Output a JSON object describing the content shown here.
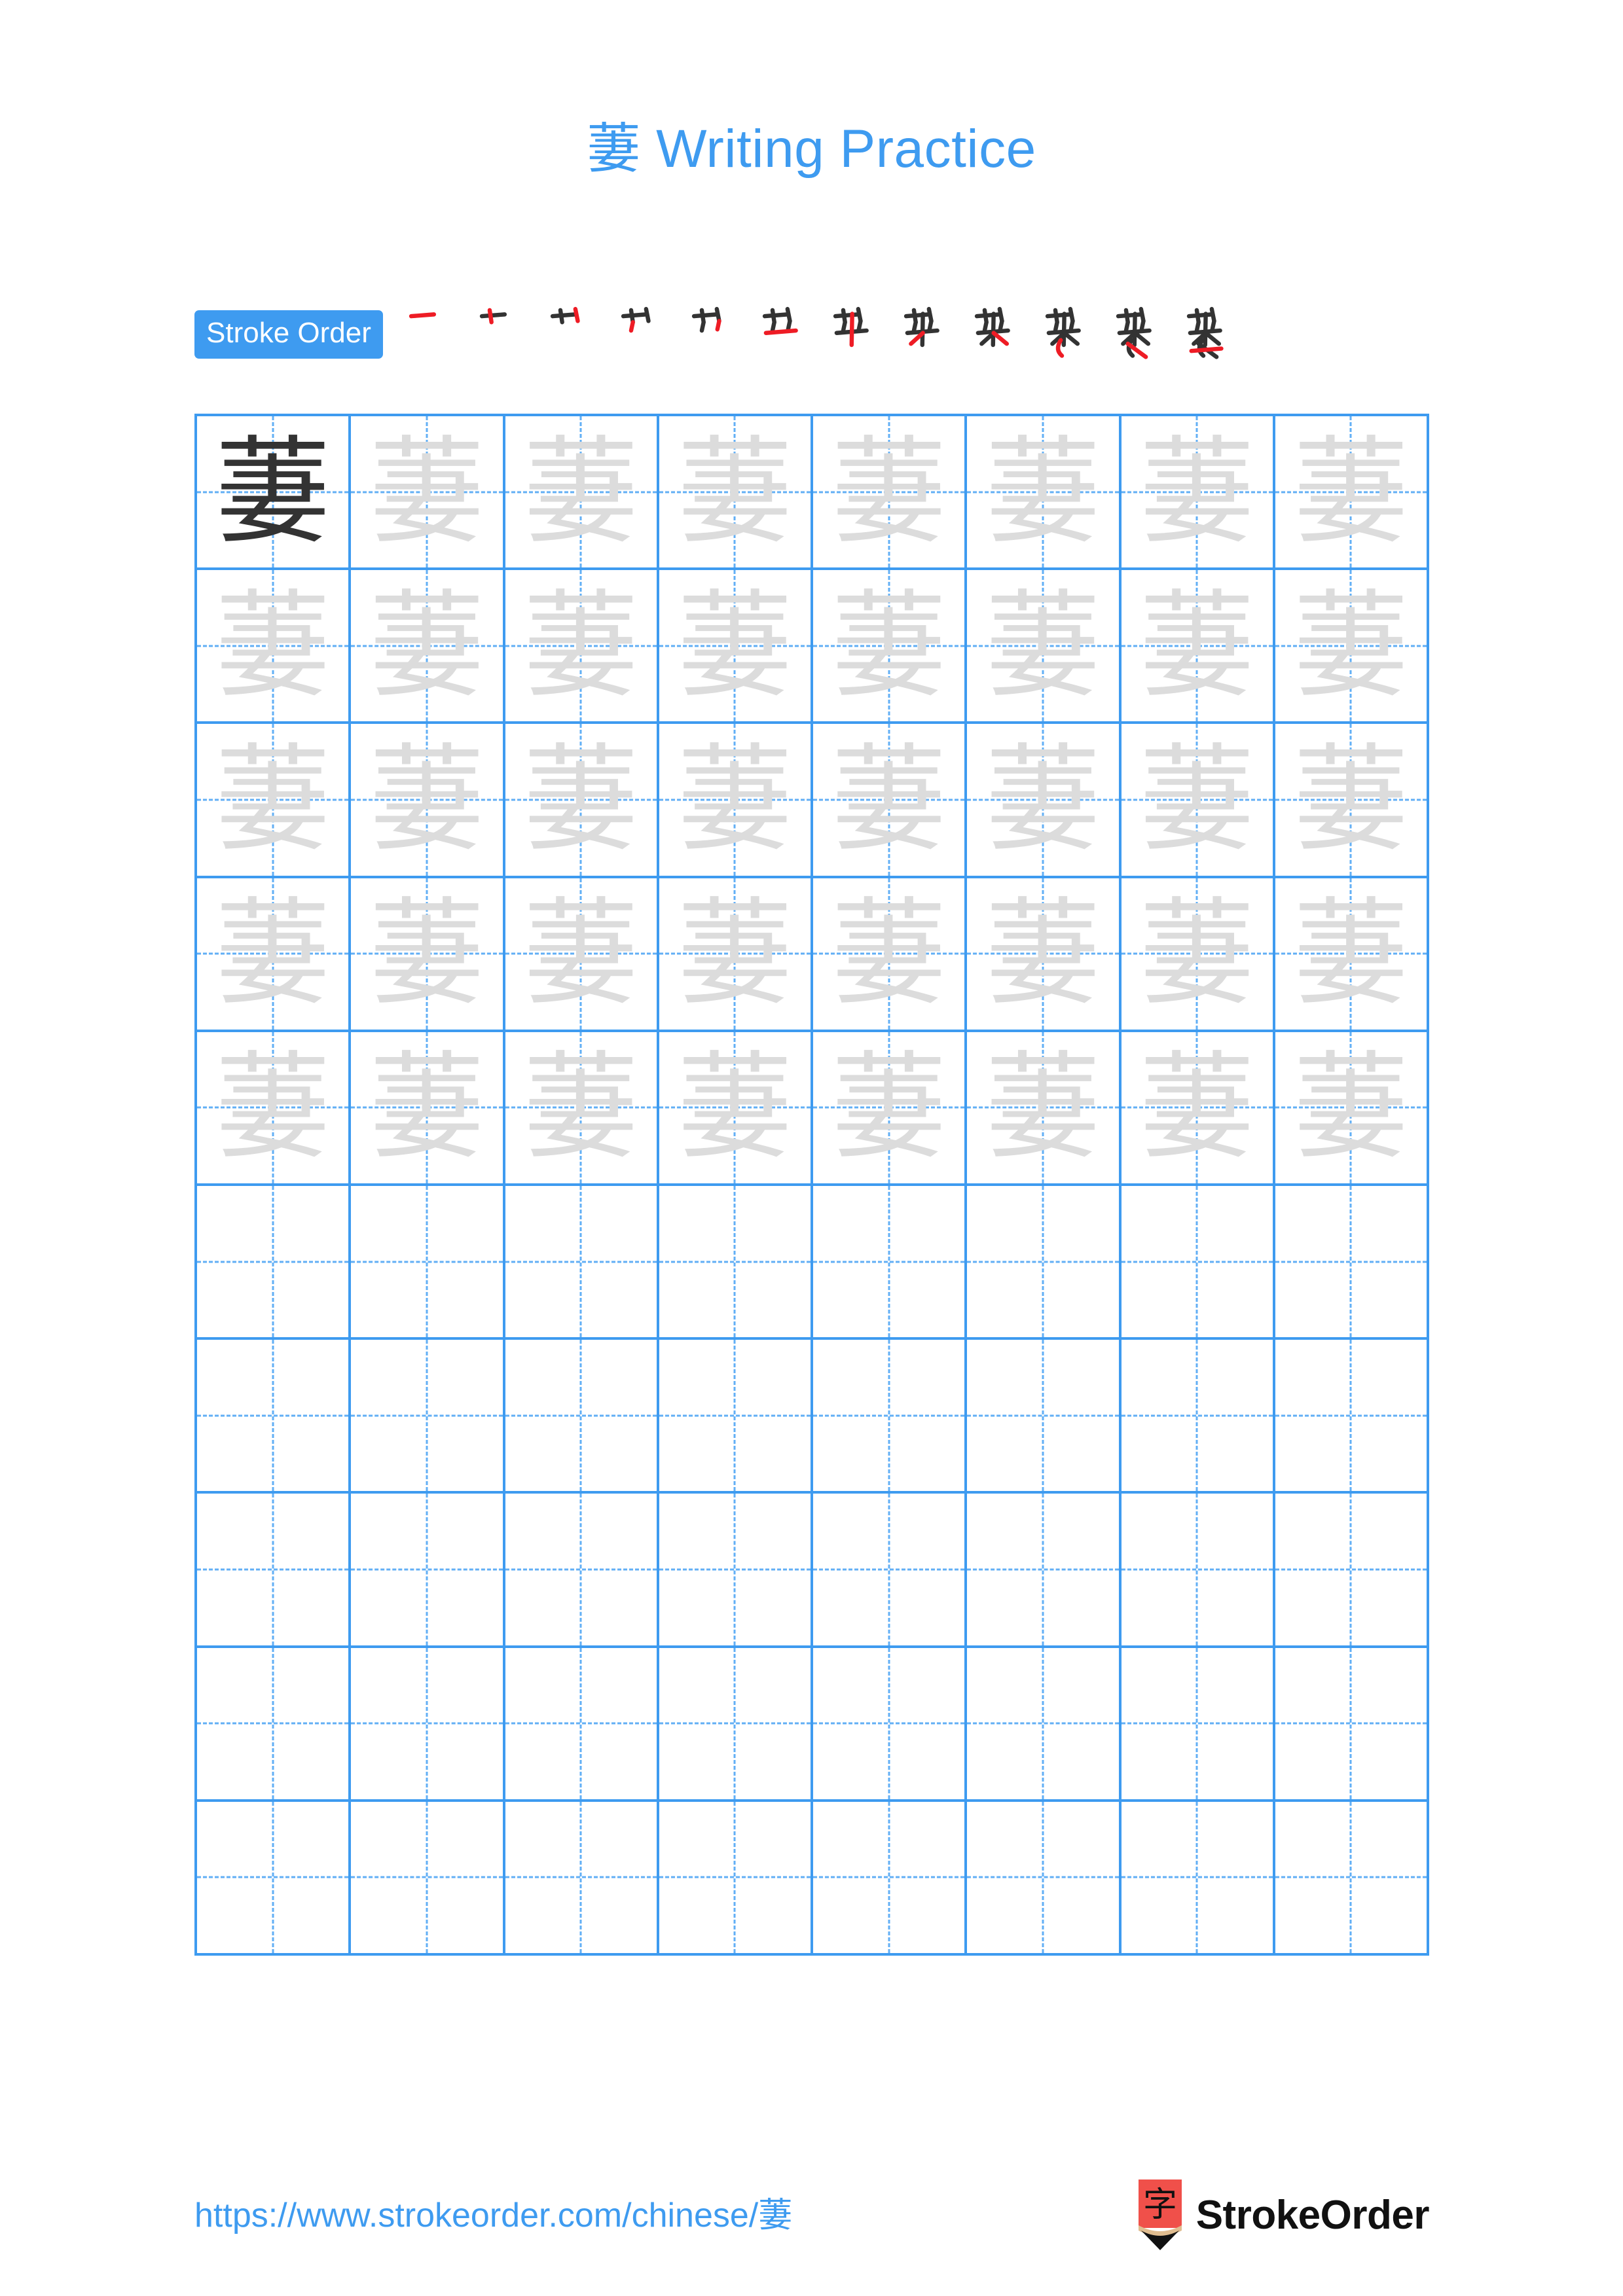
{
  "page": {
    "character": "萋",
    "title_prefix": "萋",
    "title_text": " Writing Practice",
    "accent_color": "#3e9bf0",
    "trace_color": "#dcdcdc",
    "dark_color": "#333333",
    "stroke_new_color": "#ee1c25",
    "stroke_old_color": "#333333"
  },
  "stroke_order": {
    "badge_label": "Stroke Order",
    "total_steps": 12,
    "steps": [
      {
        "index": 1,
        "partial": "一"
      },
      {
        "index": 2,
        "partial": "十"
      },
      {
        "index": 3,
        "partial": "艹"
      },
      {
        "index": 4,
        "partial": "艹"
      },
      {
        "index": 5,
        "partial": "艹"
      },
      {
        "index": 6,
        "partial": "芏"
      },
      {
        "index": 7,
        "partial": "苹"
      },
      {
        "index": 8,
        "partial": "苹"
      },
      {
        "index": 9,
        "partial": "莱"
      },
      {
        "index": 10,
        "partial": "萋"
      },
      {
        "index": 11,
        "partial": "萋"
      },
      {
        "index": 12,
        "partial": "萋"
      }
    ]
  },
  "grid": {
    "columns": 8,
    "rows": 10,
    "cells": [
      [
        "dark",
        "trace",
        "trace",
        "trace",
        "trace",
        "trace",
        "trace",
        "trace"
      ],
      [
        "trace",
        "trace",
        "trace",
        "trace",
        "trace",
        "trace",
        "trace",
        "trace"
      ],
      [
        "trace",
        "trace",
        "trace",
        "trace",
        "trace",
        "trace",
        "trace",
        "trace"
      ],
      [
        "trace",
        "trace",
        "trace",
        "trace",
        "trace",
        "trace",
        "trace",
        "trace"
      ],
      [
        "trace",
        "trace",
        "trace",
        "trace",
        "trace",
        "trace",
        "trace",
        "trace"
      ],
      [
        "empty",
        "empty",
        "empty",
        "empty",
        "empty",
        "empty",
        "empty",
        "empty"
      ],
      [
        "empty",
        "empty",
        "empty",
        "empty",
        "empty",
        "empty",
        "empty",
        "empty"
      ],
      [
        "empty",
        "empty",
        "empty",
        "empty",
        "empty",
        "empty",
        "empty",
        "empty"
      ],
      [
        "empty",
        "empty",
        "empty",
        "empty",
        "empty",
        "empty",
        "empty",
        "empty"
      ],
      [
        "empty",
        "empty",
        "empty",
        "empty",
        "empty",
        "empty",
        "empty",
        "empty"
      ]
    ]
  },
  "footer": {
    "url": "https://www.strokeorder.com/chinese/萋",
    "brand_name": "StrokeOrder",
    "logo_char": "字",
    "logo_body_color": "#f0504a",
    "logo_wood_color": "#e0bd90",
    "logo_tip_color": "#111111"
  }
}
